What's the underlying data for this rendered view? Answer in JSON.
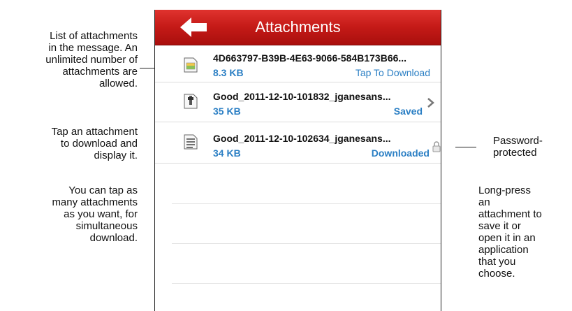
{
  "annotations": {
    "list_desc": [
      "List of attachments",
      "in the message. An",
      "unlimited number of",
      "attachments are",
      "allowed."
    ],
    "tap_desc": [
      "Tap an attachment",
      "to download and",
      "display it."
    ],
    "multi_desc": [
      "You can tap as",
      "many attachments",
      "as you want, for",
      "simultaneous",
      "download."
    ],
    "password_desc": [
      "Password-",
      "protected"
    ],
    "longpress_desc": [
      "Long-press",
      "an",
      "attachment to",
      "save it or",
      "open it in an",
      "application",
      "that you",
      "choose."
    ]
  },
  "header": {
    "title": "Attachments",
    "back_icon": "back-arrow-icon",
    "color": "#c41a17"
  },
  "attachments": [
    {
      "name": "4D663797-B39B-4E63-9066-584B173B66...",
      "size": "8.3 KB",
      "status": "Tap To Download",
      "icon": "image-file-icon"
    },
    {
      "name": "Good_2011-12-10-101832_jganesans...",
      "size": "35 KB",
      "status": "Saved",
      "icon": "zip-file-icon"
    },
    {
      "name": "Good_2011-12-10-102634_jganesans...",
      "size": "34 KB",
      "status": "Downloaded",
      "icon": "text-file-icon"
    }
  ],
  "colors": {
    "status_blue": "#2b7fc4",
    "nav_red": "#c41a17"
  }
}
